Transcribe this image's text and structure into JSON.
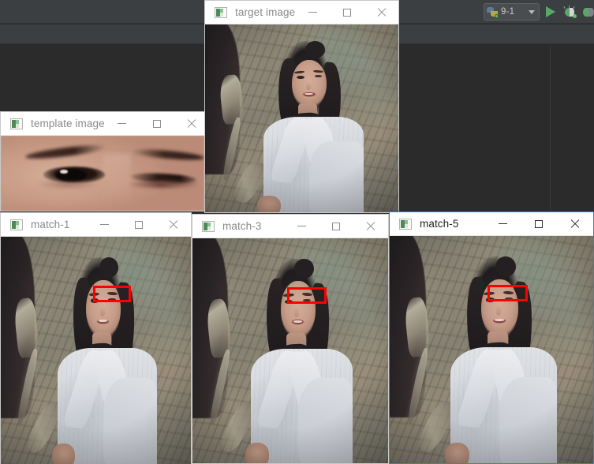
{
  "ide": {
    "run_config": {
      "label": "9-1",
      "icon": "python-icon",
      "dropdown_icon": "chevron-down-icon"
    },
    "buttons": [
      {
        "name": "run-button",
        "icon": "run-triangle-icon",
        "color": "#59a869"
      },
      {
        "name": "debug-button",
        "icon": "bug-icon",
        "color": "#59a869"
      },
      {
        "name": "coverage-button",
        "icon": "coverage-icon",
        "color": "#59a869"
      }
    ],
    "colors": {
      "toolbar_bg": "#3c3f41",
      "editor_bg": "#2b2b2b",
      "accent_green": "#59a869"
    }
  },
  "windows": [
    {
      "id": "target-image",
      "title": "target image",
      "active": false,
      "app_icon": "image-viewer-icon",
      "controls": {
        "minimize": "minimize-icon",
        "maximize": "maximize-icon",
        "close": "close-icon"
      },
      "has_match_rect": false
    },
    {
      "id": "template-image",
      "title": "template image",
      "active": false,
      "app_icon": "image-viewer-icon",
      "controls": {
        "minimize": "minimize-icon",
        "maximize": "maximize-icon",
        "close": "close-icon"
      },
      "content": "eye-region-crop"
    },
    {
      "id": "match-1",
      "title": "match-1",
      "active": false,
      "app_icon": "image-viewer-icon",
      "controls": {
        "minimize": "minimize-icon",
        "maximize": "maximize-icon",
        "close": "close-icon"
      },
      "has_match_rect": true
    },
    {
      "id": "match-3",
      "title": "match-3",
      "active": false,
      "app_icon": "image-viewer-icon",
      "controls": {
        "minimize": "minimize-icon",
        "maximize": "maximize-icon",
        "close": "close-icon"
      },
      "has_match_rect": true
    },
    {
      "id": "match-5",
      "title": "match-5",
      "active": true,
      "app_icon": "image-viewer-icon",
      "controls": {
        "minimize": "minimize-icon",
        "maximize": "maximize-icon",
        "close": "close-icon"
      },
      "has_match_rect": true
    }
  ],
  "match_rect": {
    "color": "#fe0000",
    "border_width": 3
  }
}
